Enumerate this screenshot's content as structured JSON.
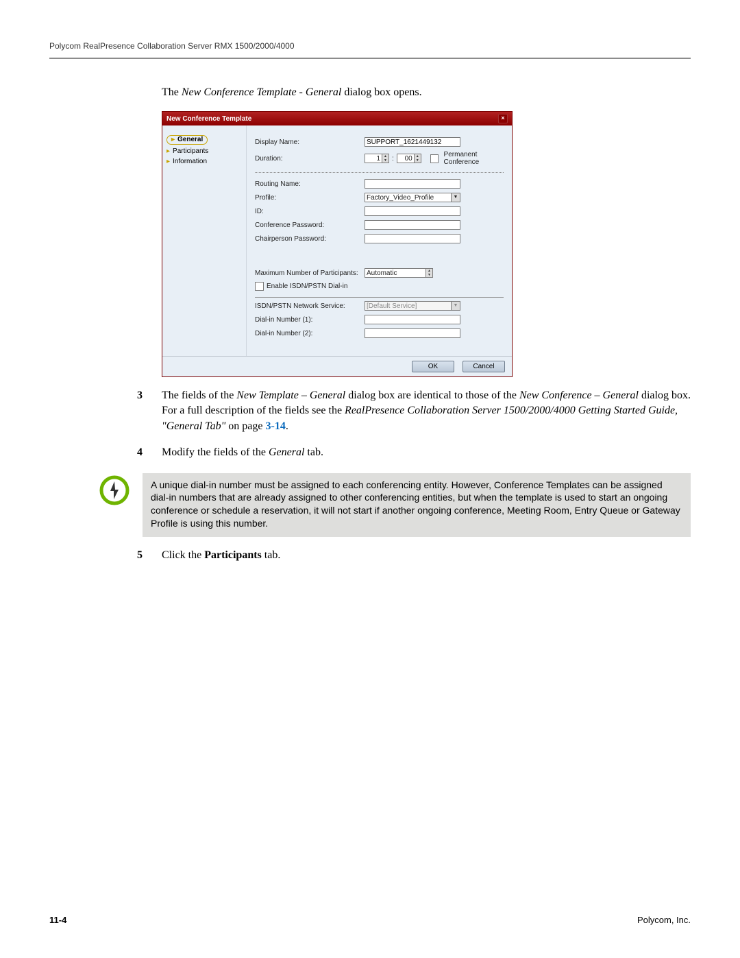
{
  "header": "Polycom RealPresence Collaboration Server RMX 1500/2000/4000",
  "intro": {
    "prefix": "The ",
    "italic": "New Conference Template - General",
    "suffix": " dialog box opens."
  },
  "dialog": {
    "title": "New Conference Template",
    "sidebar": [
      "General",
      "Participants",
      "Information"
    ],
    "labels": {
      "display_name": "Display Name:",
      "duration": "Duration:",
      "permanent": "Permanent Conference",
      "routing_name": "Routing Name:",
      "profile": "Profile:",
      "id": "ID:",
      "conf_pw": "Conference Password:",
      "chair_pw": "Chairperson Password:",
      "max_part": "Maximum Number of Participants:",
      "enable_isdn": "Enable ISDN/PSTN Dial-in",
      "isdn_service": "ISDN/PSTN Network Service:",
      "dial1": "Dial-in Number (1):",
      "dial2": "Dial-in Number (2):"
    },
    "values": {
      "display_name": "SUPPORT_1621449132",
      "duration_h": "1",
      "duration_m": "00",
      "profile": "Factory_Video_Profile",
      "max_part": "Automatic",
      "isdn_service": "[Default Service]"
    },
    "buttons": {
      "ok": "OK",
      "cancel": "Cancel"
    }
  },
  "steps": {
    "step3": {
      "num": "3",
      "t1": "The fields of the ",
      "i1": "New Template – General",
      "t2": " dialog box are identical to those of the ",
      "i2": "New Conference – General",
      "t3": " dialog box. For a full description of the fields see the ",
      "i3": "RealPresence Collaboration Server 1500/2000/4000 Getting Started Guide, \"General Tab\"",
      "t4": " on page ",
      "link": "3-14",
      "t5": "."
    },
    "step4": {
      "num": "4",
      "t1": "Modify the fields of the ",
      "i1": "General",
      "t2": " tab."
    },
    "step5": {
      "num": "5",
      "t1": "Click the ",
      "b1": "Participants",
      "t2": " tab."
    }
  },
  "note": "A unique dial-in number must be assigned to each conferencing entity. However, Conference Templates can be assigned dial-in numbers that are already assigned to other conferencing entities, but when the template is used to start an ongoing conference or schedule a reservation, it will not start if another ongoing conference, Meeting Room, Entry Queue or Gateway Profile is using this number.",
  "footer": {
    "page": "11-4",
    "company": "Polycom, Inc."
  }
}
